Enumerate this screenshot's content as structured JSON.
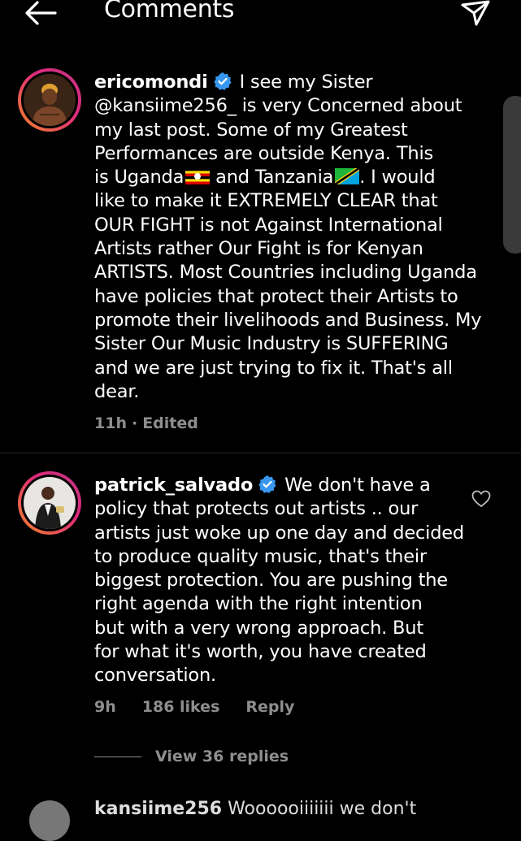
{
  "header": {
    "title": "Comments",
    "back_icon": "arrow-left-icon",
    "send_icon": "paper-plane-icon"
  },
  "comments": [
    {
      "username": "ericomondi",
      "verified": true,
      "lines": [
        "I see my Sister",
        "@kansiime256_ is very Concerned about",
        "my last post. Some of my Greatest",
        "Performances are outside Kenya. This",
        "is Uganda",
        "and Tanzania",
        ". I would",
        "like to make it EXTREMELY CLEAR that",
        "OUR FIGHT is not Against International",
        "Artists rather Our Fight is for Kenyan",
        "ARTISTS. Most Countries including Uganda",
        "have policies that protect their Artists to",
        "promote their livelihoods and Business. My",
        "Sister Our Music Industry is SUFFERING",
        "and we are just trying to fix it. That's all",
        "dear."
      ],
      "time": "11h",
      "edited": "Edited"
    },
    {
      "username": "patrick_salvado",
      "verified": true,
      "lines": [
        "We don't have a",
        "policy that protects out artists .. our",
        "artists just woke up one day and decided",
        "to produce quality music, that's their",
        "biggest protection. You are pushing the",
        "right agenda with the right intention",
        "but with a very wrong approach. But",
        "for what it's worth, you have created",
        "conversation."
      ],
      "time": "9h",
      "likes": "186 likes",
      "reply": "Reply",
      "view_replies": "View 36 replies"
    }
  ],
  "next_comment_peek": {
    "username": "kansiime256",
    "text": "Woooooiiiiiii we don't"
  },
  "colors": {
    "background": "#000000",
    "meta_text": "#8e8e8e",
    "verified": "#3897f0",
    "divider": "#262626"
  }
}
